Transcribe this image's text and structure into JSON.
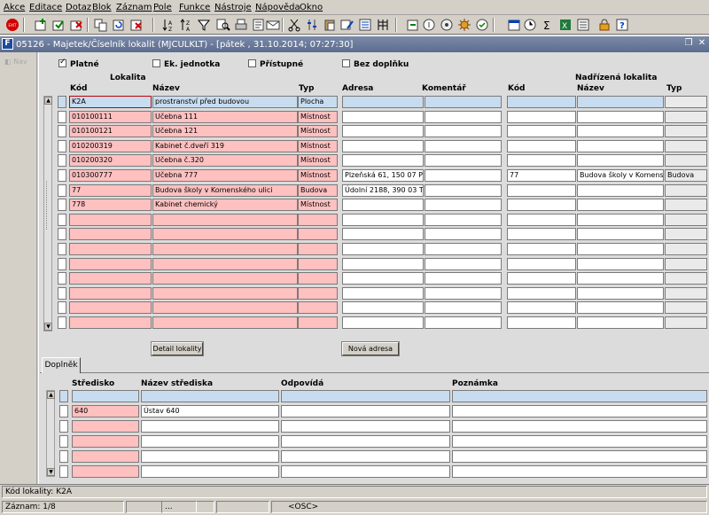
{
  "menu": [
    "Akce",
    "Editace",
    "Dotaz",
    "Blok",
    "Záznam",
    "Pole",
    "Funkce",
    "Nástroje",
    "Nápověda",
    "Okno"
  ],
  "window": {
    "icon_letter": "F",
    "title": "05126 - Majetek/Číselník lokalit (MJCULKLT) - [pátek  , 31.10.2014; 07:27:30]"
  },
  "nav": {
    "label": "Nav"
  },
  "filters": {
    "platne": "Platné",
    "ek_jednotka": "Ek. jednotka",
    "pristupne": "Přístupné",
    "bez_doplnku": "Bez doplňku"
  },
  "lokality": {
    "group_title": "Lokalita",
    "headers": {
      "kod": "Kód",
      "nazev": "Název",
      "typ": "Typ",
      "adresa": "Adresa",
      "komentar": "Komentář"
    },
    "rows": [
      {
        "kod": "K2A",
        "nazev": "prostranství před budovou",
        "typ": "Plocha",
        "adresa": "",
        "komentar": "",
        "nkod": "",
        "nnazev": "",
        "ntyp": ""
      },
      {
        "kod": "010100111",
        "nazev": "Učebna 111",
        "typ": "Místnost",
        "adresa": "",
        "komentar": "",
        "nkod": "",
        "nnazev": "",
        "ntyp": ""
      },
      {
        "kod": "010100121",
        "nazev": "Učebna 121",
        "typ": "Místnost",
        "adresa": "",
        "komentar": "",
        "nkod": "",
        "nnazev": "",
        "ntyp": ""
      },
      {
        "kod": "010200319",
        "nazev": "Kabinet č.dveří 319",
        "typ": "Místnost",
        "adresa": "",
        "komentar": "",
        "nkod": "",
        "nnazev": "",
        "ntyp": ""
      },
      {
        "kod": "010200320",
        "nazev": "Učebna č.320",
        "typ": "Místnost",
        "adresa": "",
        "komentar": "",
        "nkod": "",
        "nnazev": "",
        "ntyp": ""
      },
      {
        "kod": "010300777",
        "nazev": "Učebna 777",
        "typ": "Místnost",
        "adresa": "Plzeňská 61, 150 07 PR",
        "komentar": "",
        "nkod": "77",
        "nnazev": "Budova školy v Komensk",
        "ntyp": "Budova"
      },
      {
        "kod": "77",
        "nazev": "Budova školy v Komenského ulici",
        "typ": "Budova",
        "adresa": "Údolní 2188, 390 03 TÁ",
        "komentar": "",
        "nkod": "",
        "nnazev": "",
        "ntyp": ""
      },
      {
        "kod": "778",
        "nazev": "Kabinet chemický",
        "typ": "Místnost",
        "adresa": "",
        "komentar": "",
        "nkod": "",
        "nnazev": "",
        "ntyp": ""
      },
      {
        "kod": "",
        "nazev": "",
        "typ": "",
        "adresa": "",
        "komentar": "",
        "nkod": "",
        "nnazev": "",
        "ntyp": ""
      },
      {
        "kod": "",
        "nazev": "",
        "typ": "",
        "adresa": "",
        "komentar": "",
        "nkod": "",
        "nnazev": "",
        "ntyp": ""
      },
      {
        "kod": "",
        "nazev": "",
        "typ": "",
        "adresa": "",
        "komentar": "",
        "nkod": "",
        "nnazev": "",
        "ntyp": ""
      },
      {
        "kod": "",
        "nazev": "",
        "typ": "",
        "adresa": "",
        "komentar": "",
        "nkod": "",
        "nnazev": "",
        "ntyp": ""
      },
      {
        "kod": "",
        "nazev": "",
        "typ": "",
        "adresa": "",
        "komentar": "",
        "nkod": "",
        "nnazev": "",
        "ntyp": ""
      },
      {
        "kod": "",
        "nazev": "",
        "typ": "",
        "adresa": "",
        "komentar": "",
        "nkod": "",
        "nnazev": "",
        "ntyp": ""
      },
      {
        "kod": "",
        "nazev": "",
        "typ": "",
        "adresa": "",
        "komentar": "",
        "nkod": "",
        "nnazev": "",
        "ntyp": ""
      },
      {
        "kod": "",
        "nazev": "",
        "typ": "",
        "adresa": "",
        "komentar": "",
        "nkod": "",
        "nnazev": "",
        "ntyp": ""
      }
    ]
  },
  "nadrizena": {
    "group_title": "Nadřízená lokalita",
    "headers": {
      "kod": "Kód",
      "nazev": "Název",
      "typ": "Typ"
    }
  },
  "buttons": {
    "detail": "Detail lokality",
    "nova_adresa": "Nová adresa"
  },
  "tab": {
    "label": "Doplněk"
  },
  "doplnek": {
    "headers": {
      "stredisko": "Středisko",
      "nazev": "Název střediska",
      "odpovida": "Odpovídá",
      "poznamka": "Poznámka"
    },
    "rows": [
      {
        "stredisko": "",
        "nazev": "",
        "odpovida": "",
        "poznamka": ""
      },
      {
        "stredisko": "640",
        "nazev": "Ústav 640",
        "odpovida": "",
        "poznamka": ""
      },
      {
        "stredisko": "",
        "nazev": "",
        "odpovida": "",
        "poznamka": ""
      },
      {
        "stredisko": "",
        "nazev": "",
        "odpovida": "",
        "poznamka": ""
      },
      {
        "stredisko": "",
        "nazev": "",
        "odpovida": "",
        "poznamka": ""
      },
      {
        "stredisko": "",
        "nazev": "",
        "odpovida": "",
        "poznamka": ""
      }
    ]
  },
  "status": {
    "line1": "Kód lokality: K2A",
    "record": "Záznam: 1/8",
    "ellipsis": "...",
    "osc": "<OSC>"
  }
}
